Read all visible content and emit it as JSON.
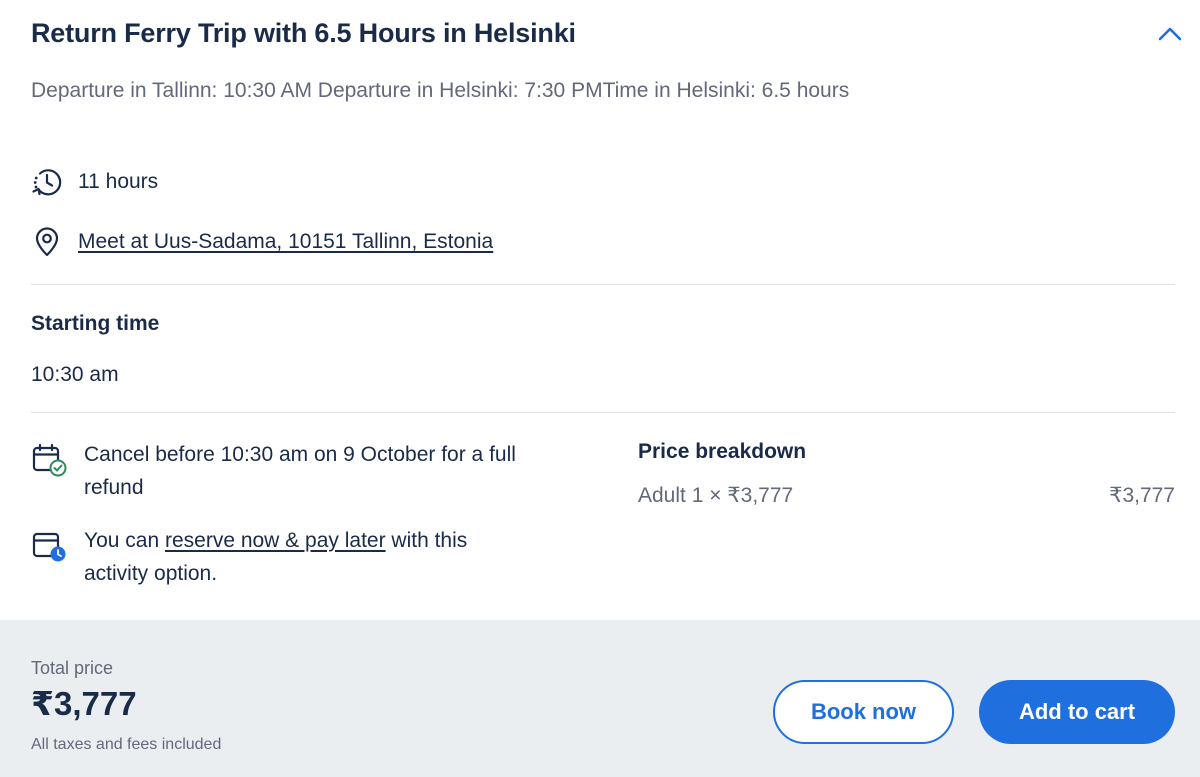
{
  "option": {
    "title": "Return Ferry Trip with 6.5 Hours in Helsinki",
    "description": "Departure in Tallinn: 10:30 AM Departure in Helsinki: 7:30 PMTime in Helsinki: 6.5 hours",
    "duration": "11 hours",
    "meeting_point": "Meet at Uus-Sadama, 10151 Tallinn, Estonia"
  },
  "starting_time": {
    "heading": "Starting time",
    "value": "10:30 am"
  },
  "policies": {
    "cancel_text": "Cancel before 10:30 am on 9 October for a full refund",
    "reserve_prefix": "You can ",
    "reserve_link": "reserve now & pay later",
    "reserve_suffix": " with this activity option."
  },
  "price_breakdown": {
    "heading": "Price breakdown",
    "line_label": "Adult 1 × ₹3,777",
    "line_amount": "₹3,777"
  },
  "footer": {
    "total_label": "Total price",
    "total_value": "₹3,777",
    "total_note": "All taxes and fees included",
    "book_now_label": "Book now",
    "add_to_cart_label": "Add to cart"
  },
  "colors": {
    "primary_blue": "#1f6fde",
    "text_dark": "#1a2b49",
    "text_muted": "#63687a",
    "footer_bg": "#ebeef1",
    "check_green": "#2e8b57"
  },
  "icons": {
    "collapse": "chevron-up-icon",
    "duration": "clock-history-icon",
    "location": "map-pin-icon",
    "cancel": "calendar-check-icon",
    "reserve": "calendar-clock-icon"
  }
}
